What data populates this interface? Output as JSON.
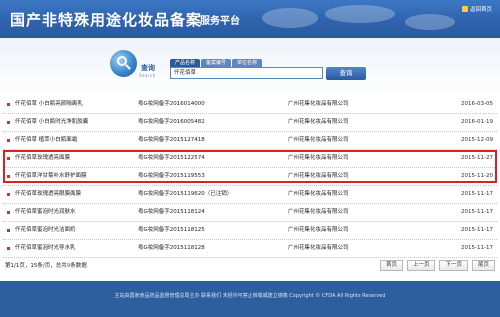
{
  "header": {
    "title": "国产非特殊用途化妆品备案",
    "subtitle": "服务平台",
    "home_label": "返回首页"
  },
  "search": {
    "label": "查询",
    "label_en": "Search",
    "tabs": [
      {
        "label": "产品名称",
        "active": true
      },
      {
        "label": "备案编号",
        "active": false
      },
      {
        "label": "单位名称",
        "active": false
      }
    ],
    "input_value": "仟花佰草",
    "button_label": "查询"
  },
  "table": {
    "rows": [
      {
        "name": "仟花佰草 小白瓶亮颜隔离乳",
        "reg": "粤G妆网备字2016014000",
        "company": "广州花集化妆品有限公司",
        "date": "2016-03-05"
      },
      {
        "name": "仟花佰草 小白瓶时光净肌胶囊",
        "reg": "粤G妆网备字2016005482",
        "company": "广州花集化妆品有限公司",
        "date": "2016-01-19"
      },
      {
        "name": "仟花佰草 植萃小白瓶面霜",
        "reg": "粤G妆网备字2015127418",
        "company": "广州花集化妆品有限公司",
        "date": "2015-12-09"
      },
      {
        "name": "仟花佰草玫瑰透亮面膜",
        "reg": "粤G妆网备字2015122574",
        "company": "广州花集化妆品有限公司",
        "date": "2015-11-27"
      },
      {
        "name": "仟花佰草洋甘菊补水舒护面膜",
        "reg": "粤G妆网备字2015119553",
        "company": "广州花集化妆品有限公司",
        "date": "2015-11-20"
      },
      {
        "name": "仟花佰草玫瑰透亮眼膜面膜",
        "reg": "粤G妆网备字2015119620（已注销）",
        "company": "广州花集化妆品有限公司",
        "date": "2015-11-17"
      },
      {
        "name": "仟花佰草蜜泡时光润肤水",
        "reg": "粤G妆网备字2015118124",
        "company": "广州花集化妆品有限公司",
        "date": "2015-11-17"
      },
      {
        "name": "仟花佰草蜜泡时光洁面奶",
        "reg": "粤G妆网备字2015118125",
        "company": "广州花集化妆品有限公司",
        "date": "2015-11-17"
      },
      {
        "name": "仟花佰草蜜泡时光导水乳",
        "reg": "粤G妆网备字2015118128",
        "company": "广州花集化妆品有限公司",
        "date": "2015-11-17"
      }
    ]
  },
  "pager": {
    "info_prefix": "第1/1页，15条/页，总共",
    "total": "9",
    "info_suffix": "条数据",
    "buttons": [
      "首页",
      "上一页",
      "下一页",
      "尾页"
    ]
  },
  "footer": {
    "text": "主站由国家食品药品监督管理总局主办 联系我们 未经许可禁止转载或建立镜像 Copyright © CFDA All Rights Reserved"
  }
}
